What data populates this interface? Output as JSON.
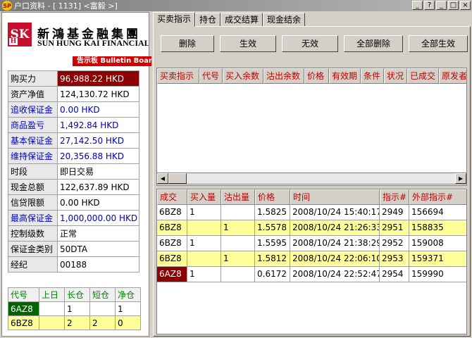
{
  "titlebar": {
    "app_icon": "SP",
    "title": "户口资料 - [ 1131] <富毅    >]",
    "controls": [
      "_",
      "?",
      "_",
      "□",
      "×"
    ]
  },
  "logo": {
    "mark": "SHK",
    "chinese": "新鴻基金融集團",
    "english": "SUN HUNG KAI FINANCIAL",
    "bulletin": "告示板  Bulletin Board"
  },
  "account": [
    {
      "label": "购买力",
      "value": "96,988.22 HKD",
      "blue": false,
      "highlight": true
    },
    {
      "label": "资产净值",
      "value": "124,130.72 HKD",
      "blue": false
    },
    {
      "label": "追收保证金",
      "value": "0.00 HKD",
      "blue": true
    },
    {
      "label": "商品盈亏",
      "value": "1,492.84 HKD",
      "blue": true
    },
    {
      "label": "基本保证金",
      "value": "27,142.50 HKD",
      "blue": true
    },
    {
      "label": "维持保证金",
      "value": "20,356.88 HKD",
      "blue": true
    },
    {
      "label": "时段",
      "value": "即日交易",
      "blue": false
    },
    {
      "label": "现金总额",
      "value": "122,637.89 HKD",
      "blue": false
    },
    {
      "label": "信贷限额",
      "value": "0.00 HKD",
      "blue": false
    },
    {
      "label": "最高保证金",
      "value": "1,000,000.00 HKD",
      "blue": true
    },
    {
      "label": "控制级数",
      "value": "正常",
      "blue": false
    },
    {
      "label": "保证金类别",
      "value": "50DTA",
      "blue": false
    },
    {
      "label": "经纪",
      "value": "00188",
      "blue": false
    }
  ],
  "positions": {
    "headers": [
      "代号",
      "上日",
      "长仓",
      "短仓",
      "净仓"
    ],
    "rows": [
      {
        "cells": [
          "6AZ8",
          "",
          "1",
          "",
          "1"
        ],
        "highlight": false
      },
      {
        "cells": [
          "6BZ8",
          "",
          "2",
          "2",
          "0"
        ],
        "highlight": true
      }
    ]
  },
  "tabs": [
    "买卖指示",
    "持仓",
    "成交结算",
    "现金结余"
  ],
  "buttons": [
    "删除",
    "生效",
    "无效",
    "全部删除",
    "全部生效"
  ],
  "orders_table": {
    "headers": [
      "买卖指示",
      "代号",
      "买入余数",
      "沽出余数",
      "价格",
      "有效期",
      "条件",
      "状况",
      "已成交",
      "原发者"
    ]
  },
  "trades_table": {
    "headers": [
      "成交",
      "买入量",
      "沽出量",
      "价格",
      "时间",
      "指示#",
      "外部指示#"
    ],
    "rows": [
      {
        "cells": [
          "6BZ8",
          "1",
          "",
          "1.5825",
          "2008/10/24 15:40:17",
          "2949",
          "156694"
        ],
        "highlight": false
      },
      {
        "cells": [
          "6BZ8",
          "",
          "1",
          "1.5578",
          "2008/10/24 21:26:33",
          "2951",
          "158835"
        ],
        "highlight": true
      },
      {
        "cells": [
          "6BZ8",
          "1",
          "",
          "1.5595",
          "2008/10/24 21:38:29",
          "2952",
          "159008"
        ],
        "highlight": false
      },
      {
        "cells": [
          "6BZ8",
          "",
          "1",
          "1.5812",
          "2008/10/24 22:06:10",
          "2953",
          "159371"
        ],
        "highlight": true
      },
      {
        "cells": [
          "6AZ8",
          "1",
          "",
          "0.6172",
          "2008/10/24 22:52:47",
          "2954",
          "159990"
        ],
        "highlight": false,
        "selected_first": true
      }
    ]
  }
}
